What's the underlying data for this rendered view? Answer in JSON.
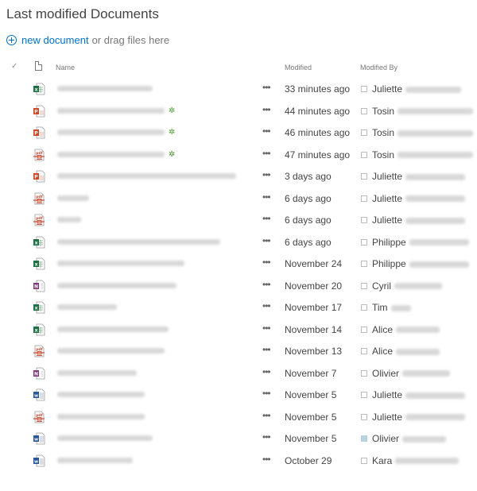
{
  "title": "Last modified Documents",
  "new_document": {
    "link_label": "new document",
    "rest_label": "or drag files here"
  },
  "columns": {
    "name": "Name",
    "modified": "Modified",
    "modified_by": "Modified By"
  },
  "rows": [
    {
      "type": "excel",
      "name": "",
      "is_new": false,
      "modified": "33 minutes ago",
      "by": "Juliette",
      "presence": false
    },
    {
      "type": "powerpoint",
      "name": "",
      "is_new": true,
      "modified": "44 minutes ago",
      "by": "Tosin",
      "presence": false
    },
    {
      "type": "powerpoint",
      "name": "",
      "is_new": true,
      "modified": "46 minutes ago",
      "by": "Tosin",
      "presence": false
    },
    {
      "type": "pdf",
      "name": "",
      "is_new": true,
      "modified": "47 minutes ago",
      "by": "Tosin",
      "presence": false
    },
    {
      "type": "powerpoint",
      "name": "",
      "is_new": false,
      "modified": "3 days ago",
      "by": "Juliette",
      "presence": false
    },
    {
      "type": "pdf",
      "name": "",
      "is_new": false,
      "modified": "6 days ago",
      "by": "Juliette",
      "presence": false
    },
    {
      "type": "pdf",
      "name": "",
      "is_new": false,
      "modified": "6 days ago",
      "by": "Juliette",
      "presence": false
    },
    {
      "type": "excel",
      "name": "",
      "is_new": false,
      "modified": "6 days ago",
      "by": "Philippe",
      "presence": false
    },
    {
      "type": "excel",
      "name": "",
      "is_new": false,
      "modified": "November 24",
      "by": "Philippe",
      "presence": false
    },
    {
      "type": "onenote",
      "name": "",
      "is_new": false,
      "modified": "November 20",
      "by": "Cyril",
      "presence": false
    },
    {
      "type": "excel",
      "name": "",
      "is_new": false,
      "modified": "November 17",
      "by": "Tim",
      "presence": false
    },
    {
      "type": "excel",
      "name": "",
      "is_new": false,
      "modified": "November 14",
      "by": "Alice",
      "presence": false
    },
    {
      "type": "pdf",
      "name": "",
      "is_new": false,
      "modified": "November 13",
      "by": "Alice",
      "presence": false
    },
    {
      "type": "onenote",
      "name": "",
      "is_new": false,
      "modified": "November 7",
      "by": "Olivier",
      "presence": false
    },
    {
      "type": "word",
      "name": "",
      "is_new": false,
      "modified": "November 5",
      "by": "Juliette",
      "presence": false
    },
    {
      "type": "pdf",
      "name": "",
      "is_new": false,
      "modified": "November 5",
      "by": "Juliette",
      "presence": false
    },
    {
      "type": "word",
      "name": "",
      "is_new": false,
      "modified": "November 5",
      "by": "Olivier",
      "presence": true
    },
    {
      "type": "word",
      "name": "",
      "is_new": false,
      "modified": "October 29",
      "by": "Kara",
      "presence": false
    }
  ],
  "icons": {
    "new_mark": "✲",
    "more": "•••",
    "check": "✓"
  },
  "colors": {
    "accent": "#0072c6",
    "excel": "#1e7145",
    "powerpoint": "#d24726",
    "word": "#2b579a",
    "onenote": "#80397b",
    "pdf": "#c8462e",
    "new_mark": "#4a9a2f"
  }
}
